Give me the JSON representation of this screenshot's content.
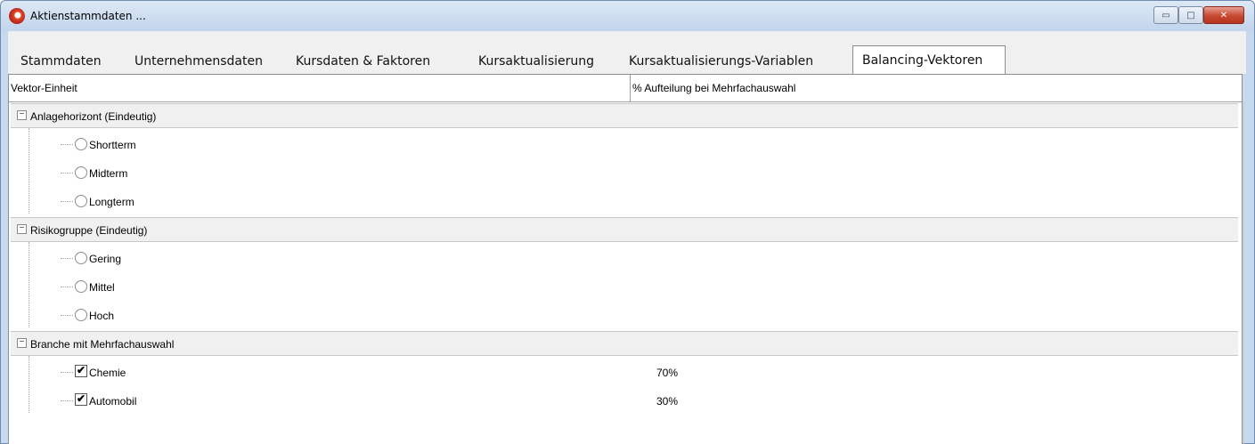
{
  "window": {
    "title": "Aktienstammdaten ...",
    "controls": {
      "minimize": "▭",
      "maximize": "□",
      "close": "✕"
    }
  },
  "tabs": [
    {
      "label": "Stammdaten"
    },
    {
      "label": "Unternehmensdaten"
    },
    {
      "label": "Kursdaten &  Faktoren"
    },
    {
      "label": "Kursaktualisierung"
    },
    {
      "label": "Kursaktualisierungs-Variablen"
    },
    {
      "label": "Balancing-Vektoren",
      "active": true
    }
  ],
  "table": {
    "col1_header": "Vektor-Einheit",
    "col2_header": "% Aufteilung bei Mehrfachauswahl"
  },
  "groups": [
    {
      "label": "Anlagehorizont (Eindeutig)",
      "toggle": "−",
      "items": [
        {
          "label": "Shortterm",
          "type": "radio",
          "checked": false
        },
        {
          "label": "Midterm",
          "type": "radio",
          "checked": false
        },
        {
          "label": "Longterm",
          "type": "radio",
          "checked": false
        }
      ]
    },
    {
      "label": "Risikogruppe (Eindeutig)",
      "toggle": "−",
      "items": [
        {
          "label": "Gering",
          "type": "radio",
          "checked": false
        },
        {
          "label": "Mittel",
          "type": "radio",
          "checked": false
        },
        {
          "label": "Hoch",
          "type": "radio",
          "checked": false
        }
      ]
    },
    {
      "label": "Branche mit Mehrfachauswahl",
      "toggle": "−",
      "items": [
        {
          "label": "Chemie",
          "type": "checkbox",
          "checked": true,
          "check_mark": "✔",
          "percent": "70%"
        },
        {
          "label": "Automobil",
          "type": "checkbox",
          "checked": true,
          "check_mark": "✔",
          "percent": "30%"
        }
      ]
    }
  ],
  "icons": {
    "app": "app-logo-icon",
    "expand_toggle": "collapse-toggle-icon"
  }
}
